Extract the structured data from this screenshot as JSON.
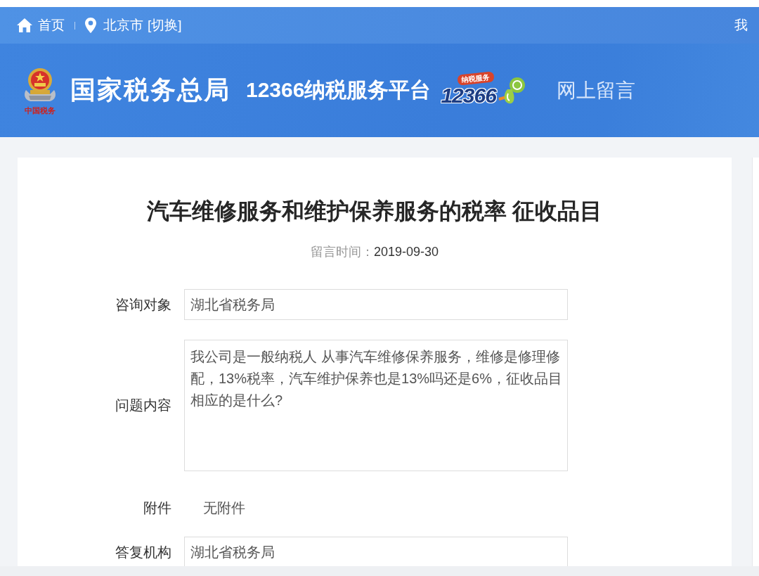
{
  "top_bar": {
    "home_link": "首页",
    "city": "北京市",
    "switch_link": "[切换]",
    "account_link": "我"
  },
  "header": {
    "emblem_caption": "中国税务",
    "agency_name": "国家税务总局",
    "platform_name": "12366纳税服务平台",
    "hotline_logo": {
      "ribbon": "纳税服务",
      "number": "12366"
    },
    "section_title": "网上留言"
  },
  "message": {
    "title": "汽车维修服务和维护保养服务的税率 征收品目",
    "time_label": "留言时间：",
    "time_value": "2019-09-30",
    "fields": [
      {
        "kind": "input",
        "label": "咨询对象",
        "value": "湖北省税务局"
      },
      {
        "kind": "textarea",
        "label": "问题内容",
        "value": "我公司是一般纳税人 从事汽车维修保养服务，维修是修理修配，13%税率，汽车维护保养也是13%吗还是6%，征收品目相应的是什么?"
      },
      {
        "kind": "text",
        "label": "附件",
        "value": "无附件"
      },
      {
        "kind": "input",
        "label": "答复机构",
        "value": "湖北省税务局"
      }
    ]
  }
}
